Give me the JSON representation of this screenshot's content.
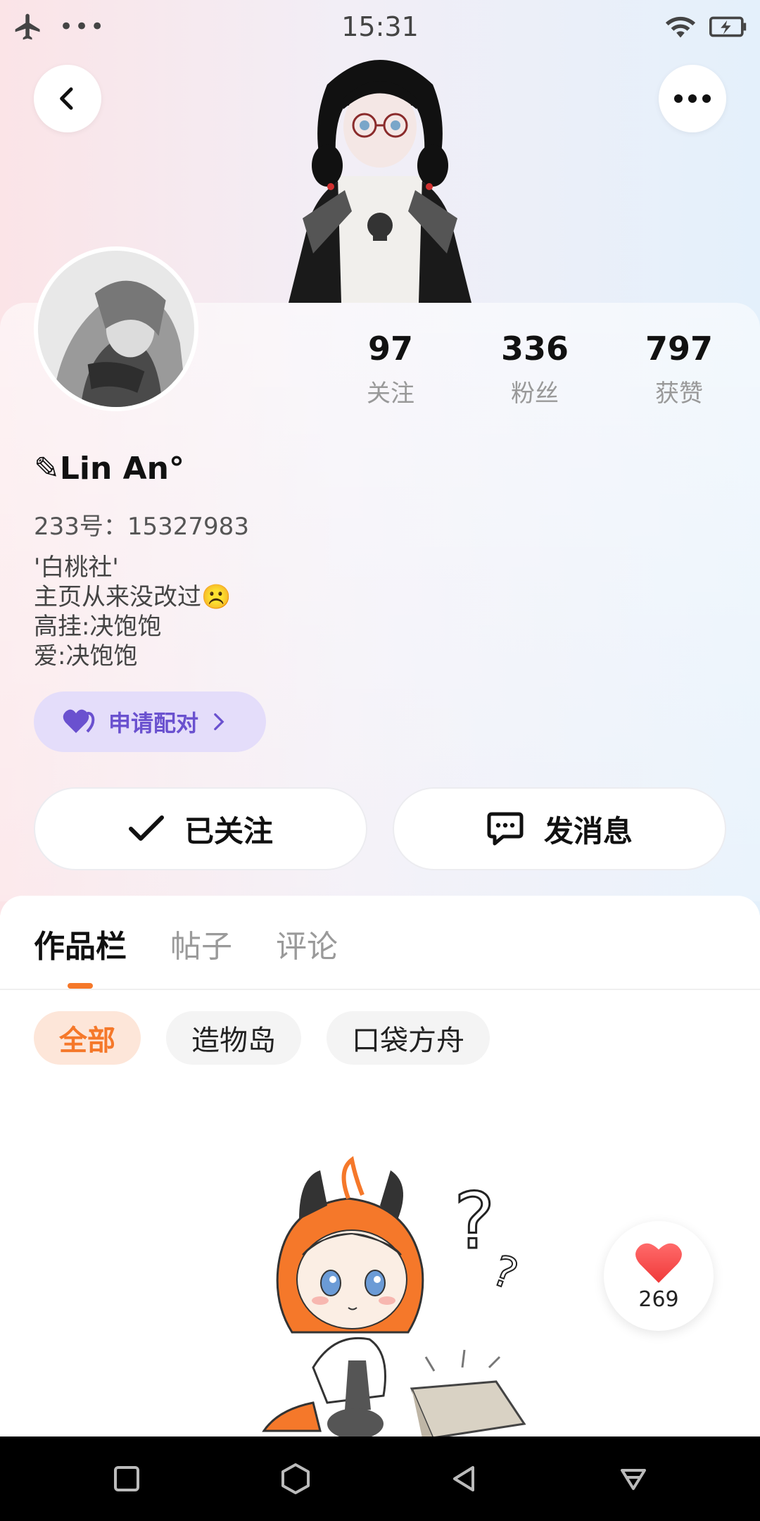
{
  "status_bar": {
    "time": "15:31"
  },
  "profile": {
    "stats": [
      {
        "value": "97",
        "label": "关注"
      },
      {
        "value": "336",
        "label": "粉丝"
      },
      {
        "value": "797",
        "label": "获赞"
      }
    ],
    "nickname": "✎Lin An°",
    "uid": "233号：15327983",
    "bio": [
      "'白桃社'",
      "主页从来没改过☹️",
      "高挂:决饱饱",
      "爱:决饱饱"
    ],
    "pair_button": "申请配对",
    "follow_button": "已关注",
    "message_button": "发消息"
  },
  "tabs": [
    {
      "label": "作品栏"
    },
    {
      "label": "帖子"
    },
    {
      "label": "评论"
    }
  ],
  "filters": [
    {
      "label": "全部"
    },
    {
      "label": "造物岛"
    },
    {
      "label": "口袋方舟"
    }
  ],
  "likes": {
    "count": "269"
  },
  "colors": {
    "accent": "#f5782a",
    "pair_purple": "#6a51cf"
  }
}
